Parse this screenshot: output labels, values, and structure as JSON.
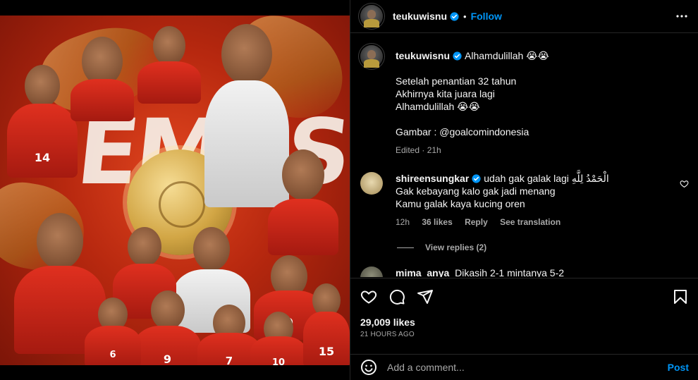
{
  "header": {
    "username": "teukuwisnu",
    "separator": "•",
    "follow_label": "Follow"
  },
  "caption": {
    "username": "teukuwisnu",
    "first_line": "Alhamdulillah 😭😭",
    "lines": [
      "Setelah penantian 32 tahun",
      "Akhirnya kita juara lagi",
      "Alhamdulillah 😭😭",
      "",
      "Gambar : @goalcomindonesia"
    ],
    "meta": "Edited · 21h"
  },
  "comment": {
    "username": "shireensungkar",
    "first_line": "udah gak galak lagi الْحَمْدُ لِلَّهِ",
    "lines": [
      "Gak kebayang kalo gak jadi menang",
      "Kamu galak kaya kucing oren"
    ],
    "time": "12h",
    "likes": "36 likes",
    "reply_label": "Reply",
    "translate_label": "See translation",
    "view_replies": "View replies (2)"
  },
  "peek_comment": {
    "username": "mima_anya",
    "text": "Dikasih 2-1 mintanya 5-2"
  },
  "actions": {
    "likes": "29,009 likes",
    "time_ago": "21 HOURS AGO"
  },
  "add_comment": {
    "placeholder": "Add a comment...",
    "post_label": "Post"
  },
  "image": {
    "headline_letters": "EMAS",
    "jersey_numbers": [
      "14",
      "9",
      "9",
      "7",
      "10",
      "15",
      "6"
    ]
  },
  "colors": {
    "background": "#000000",
    "accent_blue": "#0095f6",
    "secondary_text": "#a8a8a8",
    "divider": "#262626",
    "poster_red": "#c8321a"
  },
  "icons": {
    "verified": "verified-badge-icon",
    "more": "more-options-icon",
    "like": "heart-icon",
    "comment": "comment-icon",
    "share": "share-icon",
    "save": "bookmark-icon",
    "emoji": "emoji-icon"
  }
}
